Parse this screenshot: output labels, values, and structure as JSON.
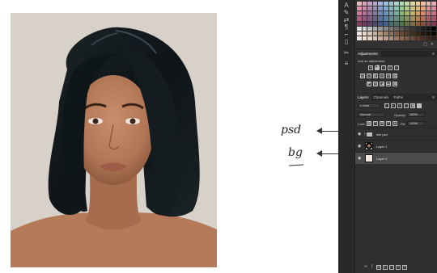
{
  "annotations": {
    "psd_label": "psd",
    "bg_label": "bg"
  },
  "panel": {
    "swatch_colors": [
      "#e9b9c6",
      "#d7a7be",
      "#c6a2c6",
      "#b8a7cf",
      "#a8b3d7",
      "#9bbfdc",
      "#9cc9d6",
      "#a9d3c9",
      "#b6d9b9",
      "#c9ddaa",
      "#ddd9a2",
      "#e9cfa0",
      "#efc0a3",
      "#efb3ab",
      "#e8aab5",
      "#dc95ae",
      "#c98aa9",
      "#b38aae",
      "#a08fbb",
      "#8d9cc6",
      "#7eaacd",
      "#7db7c5",
      "#8bc3b3",
      "#9bc99d",
      "#b2cc8b",
      "#cbc784",
      "#dcb882",
      "#e3a486",
      "#e09393",
      "#d98aa0",
      "#c67a98",
      "#b06f93",
      "#9a7098",
      "#8579a5",
      "#7388b3",
      "#6697bb",
      "#6aa5b3",
      "#78b19e",
      "#89b585",
      "#a2b872",
      "#bcb36a",
      "#cca368",
      "#d38d6b",
      "#cf7b79",
      "#c87186",
      "#a55f7c",
      "#935a7d",
      "#815c83",
      "#705f8c",
      "#60709c",
      "#5881a4",
      "#5b8f9b",
      "#688f86",
      "#72936f",
      "#87935d",
      "#9f9057",
      "#ae8154",
      "#b36e56",
      "#ad5d61",
      "#a6566d",
      "#7c425d",
      "#6d3e5f",
      "#5f4066",
      "#51456f",
      "#465581",
      "#416589",
      "#467178",
      "#4f7164",
      "#577451",
      "#667347",
      "#7a6f43",
      "#875f40",
      "#8b4f41",
      "#853f47",
      "#7e3c52",
      "#e2e2e2",
      "#cfcfcf",
      "#bdbdbd",
      "#ababab",
      "#999999",
      "#888888",
      "#777777",
      "#666666",
      "#555555",
      "#444444",
      "#383838",
      "#2c2c2c",
      "#202020",
      "#141414",
      "#000000",
      "#f1e6dd",
      "#e7d6c9",
      "#dac4b3",
      "#cab09b",
      "#b69a83",
      "#a2856d",
      "#8d7059",
      "#795d47",
      "#654b38",
      "#523b2b",
      "#40301f",
      "#2f2316",
      "#22190f",
      "#160f08",
      "#0a0704",
      "#f3ece6",
      "#ece0d6",
      "#e3d2c5",
      "#d8c2b3",
      "#cbb1a0",
      "#bc9f8c",
      "#ac8c79",
      "#9b7a67",
      "#8a6957",
      "#7a5948",
      "#6a4b3b",
      "#5b3e30",
      "#4d3326",
      "#40281d",
      "#331e15"
    ],
    "adjustments": {
      "tabs": [
        "Adjustments"
      ],
      "subtitle": "Add an adjustment"
    },
    "layers": {
      "tabs": [
        "Layers",
        "Channels",
        "Paths"
      ],
      "kind_filter": "Kind",
      "blend_mode": "Normal",
      "opacity_label": "Opacity:",
      "opacity_value": "100%",
      "lock_label": "Lock:",
      "fill_label": "Fill:",
      "fill_value": "100%",
      "items": [
        {
          "name": "sim psd",
          "type": "group"
        },
        {
          "name": "Layer 1",
          "type": "image"
        },
        {
          "name": "Layer 2",
          "type": "fill",
          "selected": true
        }
      ]
    }
  }
}
